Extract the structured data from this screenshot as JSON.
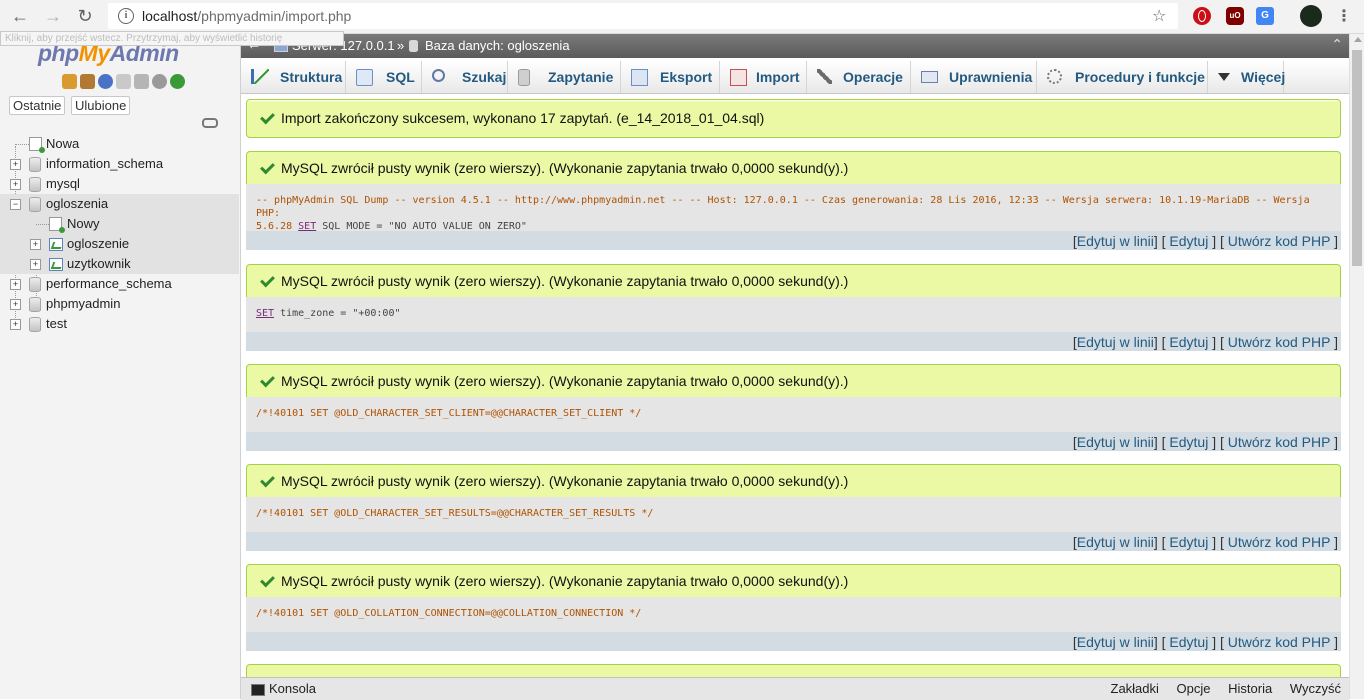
{
  "browser": {
    "url_host": "localhost",
    "url_path": "/phpmyadmin/import.php",
    "tooltip": "Kliknij, aby przejść wstecz. Przytrzymaj, aby wyświetlić historię"
  },
  "nav": {
    "logo": {
      "php": "php",
      "my": "My",
      "admin": "Admin"
    },
    "tabs": {
      "recent": "Ostatnie",
      "favorites": "Ulubione"
    },
    "tree": {
      "new": "Nowa",
      "databases": [
        {
          "name": "information_schema"
        },
        {
          "name": "mysql"
        },
        {
          "name": "ogloszenia",
          "expanded": true,
          "children_new": "Nowy",
          "tables": [
            "ogloszenie",
            "uzytkownik"
          ]
        },
        {
          "name": "performance_schema"
        },
        {
          "name": "phpmyadmin"
        },
        {
          "name": "test"
        }
      ]
    }
  },
  "breadcrumb": {
    "server": "Serwer: 127.0.0.1",
    "separator": "»",
    "database": "Baza danych: ogloszenia"
  },
  "menu": {
    "tabs": [
      "Struktura",
      "SQL",
      "Szukaj",
      "Zapytanie",
      "Eksport",
      "Import",
      "Operacje",
      "Uprawnienia",
      "Procedury i funkcje",
      "Więcej"
    ]
  },
  "import_result": {
    "message": "Import zakończony sukcesem, wykonano 17 zapytań. (e_14_2018_01_04.sql)"
  },
  "results": [
    {
      "message": "MySQL zwrócił pusty wynik (zero wierszy). (Wykonanie zapytania trwało 0,0000 sekund(y).)",
      "sql_line1": "-- phpMyAdmin SQL Dump -- version 4.5.1 -- http://www.phpmyadmin.net -- -- Host: 127.0.0.1 -- Czas generowania: 28 Lis 2016, 12:33 -- Wersja serwera: 10.1.19-MariaDB -- Wersja PHP:",
      "sql_line2_pre": "5.6.28 ",
      "sql_kw": "SET",
      "sql_line2_post": " SQL_MODE = \"NO_AUTO_VALUE_ON_ZERO\""
    },
    {
      "message": "MySQL zwrócił pusty wynik (zero wierszy). (Wykonanie zapytania trwało 0,0000 sekund(y).)",
      "sql_kw": "SET",
      "sql_rest": " time_zone = \"+00:00\""
    },
    {
      "message": "MySQL zwrócił pusty wynik (zero wierszy). (Wykonanie zapytania trwało 0,0000 sekund(y).)",
      "sql": "/*!40101 SET @OLD_CHARACTER_SET_CLIENT=@@CHARACTER_SET_CLIENT */"
    },
    {
      "message": "MySQL zwrócił pusty wynik (zero wierszy). (Wykonanie zapytania trwało 0,0000 sekund(y).)",
      "sql": "/*!40101 SET @OLD_CHARACTER_SET_RESULTS=@@CHARACTER_SET_RESULTS */"
    },
    {
      "message": "MySQL zwrócił pusty wynik (zero wierszy). (Wykonanie zapytania trwało 0,0000 sekund(y).)",
      "sql": "/*!40101 SET @OLD_COLLATION_CONNECTION=@@COLLATION_CONNECTION */"
    }
  ],
  "result_links": {
    "inline_edit": "Edytuj w linii",
    "edit": "Edytuj",
    "php_code": "Utwórz kod PHP"
  },
  "console": {
    "label": "Konsola",
    "tabs": [
      "Zakładki",
      "Opcje",
      "Historia",
      "Wyczyść"
    ]
  },
  "colors": {
    "success_bg": "#ebf8a4",
    "link": "#235a81",
    "sql_text": "#af5200"
  }
}
